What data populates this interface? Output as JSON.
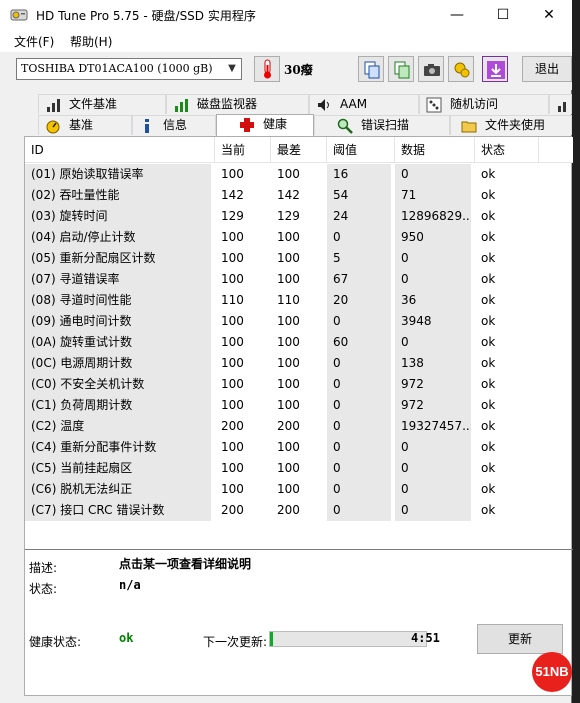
{
  "window": {
    "title": "HD Tune Pro 5.75 - 硬盘/SSD 实用程序",
    "controls": {
      "minimize": "—",
      "maximize": "☐",
      "close": "✕"
    }
  },
  "menu": {
    "file": "文件(F)",
    "help": "帮助(H)"
  },
  "toolbar": {
    "drive": "TOSHIBA DT01ACA100 (1000 gB)",
    "temperature": "30癈",
    "exit_label": "退出",
    "buttons": [
      "copy-icon",
      "save-icon",
      "camera-icon",
      "gold-icon",
      "download-icon"
    ]
  },
  "tabs": {
    "row1": [
      {
        "label": "文件基准",
        "icon": "file-benchmark-icon"
      },
      {
        "label": "磁盘监视器",
        "icon": "disk-monitor-icon"
      },
      {
        "label": "AAM",
        "icon": "speaker-icon"
      },
      {
        "label": "随机访问",
        "icon": "random-access-icon"
      }
    ],
    "row2": [
      {
        "label": "基准",
        "icon": "benchmark-icon"
      },
      {
        "label": "信息",
        "icon": "info-icon"
      },
      {
        "label": "健康",
        "icon": "health-cross-icon",
        "active": true
      },
      {
        "label": "错误扫描",
        "icon": "magnifier-icon"
      },
      {
        "label": "文件夹使用",
        "icon": "folder-icon"
      }
    ]
  },
  "smart": {
    "columns": [
      "ID",
      "当前",
      "最差",
      "阈值",
      "数据",
      "状态"
    ],
    "rows": [
      {
        "id": "(01) 原始读取错误率",
        "current": "100",
        "worst": "100",
        "threshold": "16",
        "data": "0",
        "status": "ok"
      },
      {
        "id": "(02) 吞吐量性能",
        "current": "142",
        "worst": "142",
        "threshold": "54",
        "data": "71",
        "status": "ok"
      },
      {
        "id": "(03) 旋转时间",
        "current": "129",
        "worst": "129",
        "threshold": "24",
        "data": "12896829...",
        "status": "ok"
      },
      {
        "id": "(04) 启动/停止计数",
        "current": "100",
        "worst": "100",
        "threshold": "0",
        "data": "950",
        "status": "ok"
      },
      {
        "id": "(05) 重新分配扇区计数",
        "current": "100",
        "worst": "100",
        "threshold": "5",
        "data": "0",
        "status": "ok"
      },
      {
        "id": "(07) 寻道错误率",
        "current": "100",
        "worst": "100",
        "threshold": "67",
        "data": "0",
        "status": "ok"
      },
      {
        "id": "(08) 寻道时间性能",
        "current": "110",
        "worst": "110",
        "threshold": "20",
        "data": "36",
        "status": "ok"
      },
      {
        "id": "(09) 通电时间计数",
        "current": "100",
        "worst": "100",
        "threshold": "0",
        "data": "3948",
        "status": "ok"
      },
      {
        "id": "(0A) 旋转重试计数",
        "current": "100",
        "worst": "100",
        "threshold": "60",
        "data": "0",
        "status": "ok"
      },
      {
        "id": "(0C) 电源周期计数",
        "current": "100",
        "worst": "100",
        "threshold": "0",
        "data": "138",
        "status": "ok"
      },
      {
        "id": "(C0) 不安全关机计数",
        "current": "100",
        "worst": "100",
        "threshold": "0",
        "data": "972",
        "status": "ok"
      },
      {
        "id": "(C1) 负荷周期计数",
        "current": "100",
        "worst": "100",
        "threshold": "0",
        "data": "972",
        "status": "ok"
      },
      {
        "id": "(C2) 温度",
        "current": "200",
        "worst": "200",
        "threshold": "0",
        "data": "19327457...",
        "status": "ok"
      },
      {
        "id": "(C4) 重新分配事件计数",
        "current": "100",
        "worst": "100",
        "threshold": "0",
        "data": "0",
        "status": "ok"
      },
      {
        "id": "(C5) 当前挂起扇区",
        "current": "100",
        "worst": "100",
        "threshold": "0",
        "data": "0",
        "status": "ok"
      },
      {
        "id": "(C6) 脱机无法纠正",
        "current": "100",
        "worst": "100",
        "threshold": "0",
        "data": "0",
        "status": "ok"
      },
      {
        "id": "(C7) 接口 CRC 错误计数",
        "current": "200",
        "worst": "200",
        "threshold": "0",
        "data": "0",
        "status": "ok"
      }
    ]
  },
  "details": {
    "description_label": "描述:",
    "description_value": "点击某一项查看详细说明",
    "status_label": "状态:",
    "status_value": "n/a"
  },
  "footer": {
    "health_label": "健康状态:",
    "health_value": "ok",
    "next_update_label": "下一次更新:",
    "countdown": "4:51",
    "progress_fraction": 0.02,
    "refresh_label": "更新"
  },
  "watermark": "51NB",
  "colors": {
    "ok_green": "#008000",
    "progress_green": "#06b025",
    "watermark_red": "#e8211d"
  }
}
